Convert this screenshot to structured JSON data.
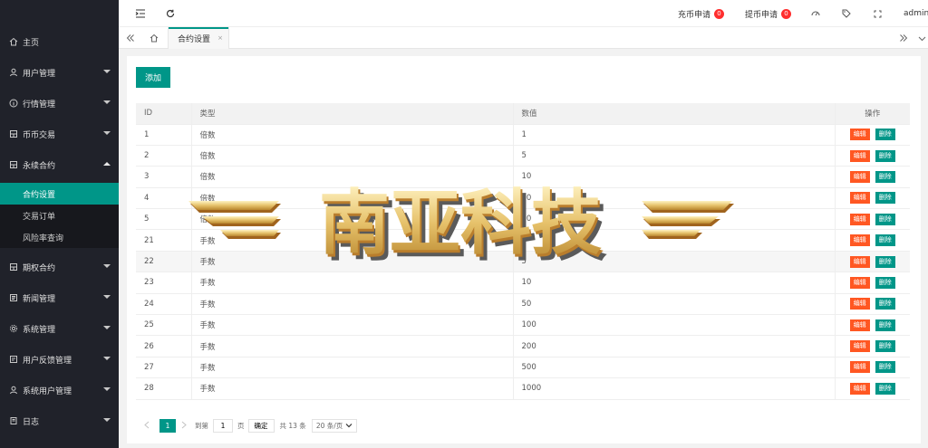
{
  "sidebar": {
    "items": [
      {
        "label": "主页",
        "icon": "home-icon"
      },
      {
        "label": "用户管理",
        "icon": "user-icon"
      },
      {
        "label": "行情管理",
        "icon": "info-icon"
      },
      {
        "label": "币币交易",
        "icon": "grid-icon"
      },
      {
        "label": "永续合约",
        "icon": "grid-icon"
      },
      {
        "label": "期权合约",
        "icon": "grid-icon"
      },
      {
        "label": "新闻管理",
        "icon": "news-icon"
      },
      {
        "label": "系统管理",
        "icon": "gear-icon"
      },
      {
        "label": "用户反馈管理",
        "icon": "feedback-icon"
      },
      {
        "label": "系统用户管理",
        "icon": "user-icon"
      },
      {
        "label": "日志",
        "icon": "log-icon"
      }
    ],
    "submenu": [
      {
        "label": "合约设置"
      },
      {
        "label": "交易订单"
      },
      {
        "label": "风险率查询"
      }
    ]
  },
  "header": {
    "recharge_label": "充币申请",
    "recharge_count": "0",
    "withdraw_label": "提币申请",
    "withdraw_count": "0",
    "user": "admin"
  },
  "tabs": {
    "active_label": "合约设置",
    "close_glyph": "×"
  },
  "toolbar": {
    "add_label": "添加"
  },
  "table": {
    "columns": [
      "ID",
      "类型",
      "数值",
      "操作"
    ],
    "edit_label": "编辑",
    "delete_label": "删除",
    "rows": [
      {
        "id": "1",
        "type": "倍数",
        "value": "1"
      },
      {
        "id": "2",
        "type": "倍数",
        "value": "5"
      },
      {
        "id": "3",
        "type": "倍数",
        "value": "10"
      },
      {
        "id": "4",
        "type": "倍数",
        "value": "20"
      },
      {
        "id": "5",
        "type": "倍数",
        "value": "50"
      },
      {
        "id": "21",
        "type": "手数",
        "value": "1"
      },
      {
        "id": "22",
        "type": "手数",
        "value": "5"
      },
      {
        "id": "23",
        "type": "手数",
        "value": "10"
      },
      {
        "id": "24",
        "type": "手数",
        "value": "50"
      },
      {
        "id": "25",
        "type": "手数",
        "value": "100"
      },
      {
        "id": "26",
        "type": "手数",
        "value": "200"
      },
      {
        "id": "27",
        "type": "手数",
        "value": "500"
      },
      {
        "id": "28",
        "type": "手数",
        "value": "1000"
      }
    ]
  },
  "pager": {
    "current": "1",
    "goto_label": "到第",
    "page_input": "1",
    "page_unit": "页",
    "confirm": "确定",
    "total": "共 13 条",
    "page_size": "20 条/页"
  },
  "watermark": {
    "text": "南亚科技"
  },
  "colors": {
    "sidebar_bg": "#20222a",
    "accent": "#009688",
    "edit": "#ff5722",
    "badge": "#ff2e2e"
  }
}
